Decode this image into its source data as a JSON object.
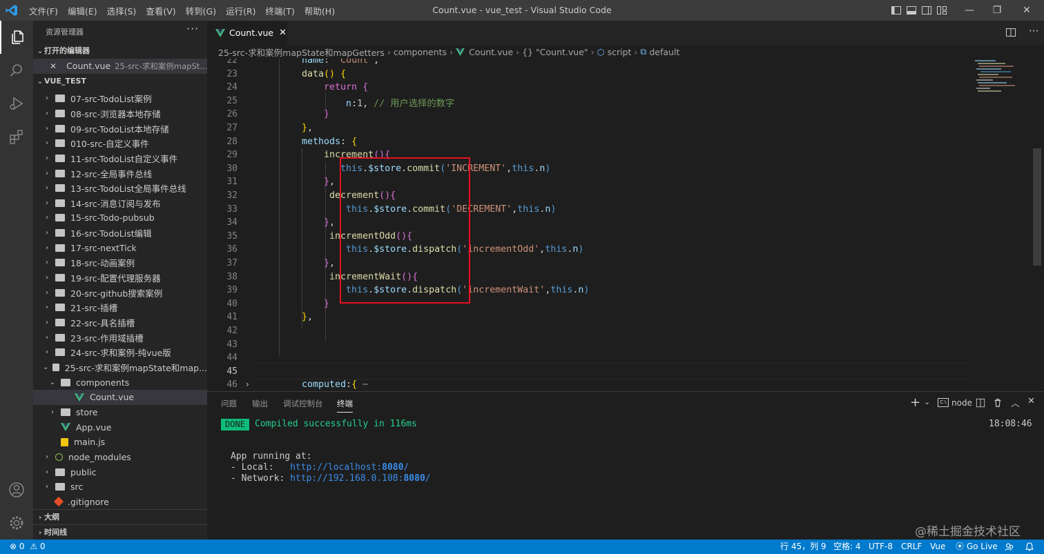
{
  "titlebar": {
    "menu": [
      "文件(F)",
      "编辑(E)",
      "选择(S)",
      "查看(V)",
      "转到(G)",
      "运行(R)",
      "终端(T)",
      "帮助(H)"
    ],
    "title": "Count.vue - vue_test - Visual Studio Code"
  },
  "sidebar": {
    "title": "资源管理器",
    "more": "···",
    "open_editors_label": "打开的编辑器",
    "open_editor_file": "Count.vue",
    "open_editor_path": "25-src-求和案例mapSt...",
    "project_label": "VUE_TEST",
    "tree": [
      {
        "label": "07-src-TodoList案例",
        "icon": "folder-icon"
      },
      {
        "label": "08-src-浏览器本地存储",
        "icon": "folder-icon"
      },
      {
        "label": "09-src-TodoList本地存储",
        "icon": "folder-icon"
      },
      {
        "label": "010-src-自定义事件",
        "icon": "folder-icon"
      },
      {
        "label": "11-src-TodoList自定义事件",
        "icon": "folder-icon"
      },
      {
        "label": "12-src-全局事件总线",
        "icon": "folder-icon"
      },
      {
        "label": "13-src-TodoList全局事件总线",
        "icon": "folder-icon"
      },
      {
        "label": "14-src-消息订阅与发布",
        "icon": "folder-icon"
      },
      {
        "label": "15-src-Todo-pubsub",
        "icon": "folder-icon"
      },
      {
        "label": "16-src-TodoList编辑",
        "icon": "folder-icon"
      },
      {
        "label": "17-src-nextTick",
        "icon": "folder-icon"
      },
      {
        "label": "18-src-动画案例",
        "icon": "folder-icon"
      },
      {
        "label": "19-src-配置代理服务器",
        "icon": "folder-icon"
      },
      {
        "label": "20-src-github搜索案例",
        "icon": "folder-icon"
      },
      {
        "label": "21-src-插槽",
        "icon": "folder-icon"
      },
      {
        "label": "22-src-具名插槽",
        "icon": "folder-icon"
      },
      {
        "label": "23-src-作用域插槽",
        "icon": "folder-icon"
      },
      {
        "label": "24-src-求和案例-纯vue版",
        "icon": "folder-icon"
      },
      {
        "label": "25-src-求和案例mapState和map...",
        "icon": "folder-icon"
      },
      {
        "label": "components",
        "icon": "folder-icon"
      },
      {
        "label": "Count.vue",
        "icon": "vue-file-icon"
      },
      {
        "label": "store",
        "icon": "folder-icon"
      },
      {
        "label": "App.vue",
        "icon": "vue-file-icon"
      },
      {
        "label": "main.js",
        "icon": "js-file-icon"
      },
      {
        "label": "node_modules",
        "icon": "node-folder-icon"
      },
      {
        "label": "public",
        "icon": "folder-icon"
      },
      {
        "label": "src",
        "icon": "folder-icon"
      },
      {
        "label": ".gitignore",
        "icon": "git-file-icon"
      }
    ],
    "outline_label": "大纲",
    "timeline_label": "时间线"
  },
  "editor": {
    "tab_label": "Count.vue",
    "breadcrumb": [
      "25-src-求和案例mapState和mapGetters",
      "components",
      "Count.vue",
      "{} \"Count.vue\"",
      "script",
      "default"
    ],
    "line_numbers": [
      "22",
      "23",
      "24",
      "25",
      "26",
      "27",
      "28",
      "29",
      "30",
      "31",
      "32",
      "33",
      "34",
      "35",
      "36",
      "37",
      "38",
      "39",
      "40",
      "41",
      "42",
      "43",
      "44",
      "45",
      "46"
    ]
  },
  "panel": {
    "tabs": [
      "问题",
      "输出",
      "调试控制台",
      "终端"
    ],
    "active_tab": "终端",
    "terminal_name": "node",
    "done_badge": "DONE",
    "compiled": "Compiled successfully in 116ms",
    "time": "18:08:46",
    "running": "App running at:",
    "local_label": "- Local:   ",
    "local_url": "http://localhost:",
    "local_port": "8080",
    "network_label": "- Network: ",
    "network_url": "http://192.168.0.108:",
    "network_port": "8080",
    "url_tail": "/"
  },
  "statusbar": {
    "errors": "0",
    "warnings": "0",
    "position": "行 45，列 9",
    "spaces": "空格: 4",
    "encoding": "UTF-8",
    "eol": "CRLF",
    "language": "Vue",
    "golive": "Go Live",
    "watermark": "@稀土掘金技术社区"
  },
  "colors": {
    "accent": "#007acc",
    "highlight_box": "#e81123",
    "done_bg": "#0dbc79"
  }
}
